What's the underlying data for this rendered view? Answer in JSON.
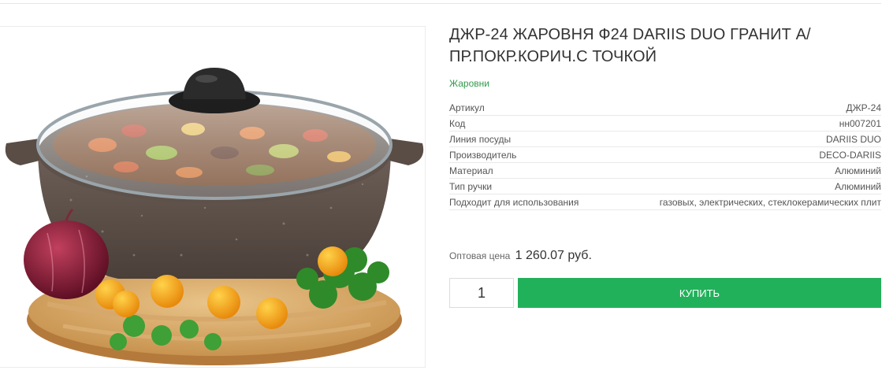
{
  "product": {
    "title": "ДЖР-24 ЖАРОВНЯ Ф24 DARIIS DUO ГРАНИТ А/ПР.ПОКР.КОРИЧ.С ТОЧКОЙ",
    "category": "Жаровни",
    "specs": [
      {
        "label": "Артикул",
        "value": "ДЖР-24"
      },
      {
        "label": "Код",
        "value": "нн007201"
      },
      {
        "label": "Линия посуды",
        "value": "DARIIS DUO"
      },
      {
        "label": "Производитель",
        "value": "DECO-DARIIS"
      },
      {
        "label": "Материал",
        "value": "Алюминий"
      },
      {
        "label": "Тип ручки",
        "value": "Алюминий"
      },
      {
        "label": "Подходит для использования",
        "value": "газовых, электрических, стеклокерамических плит"
      }
    ]
  },
  "purchase": {
    "price_label": "Оптовая цена",
    "price": "1 260.07 руб.",
    "quantity": "1",
    "buy_label": "КУПИТЬ",
    "buy_color": "#21b15a"
  },
  "image": {
    "subject": "brown granite-coated roasting pot with glass lid, vegetables, on a wooden board"
  }
}
